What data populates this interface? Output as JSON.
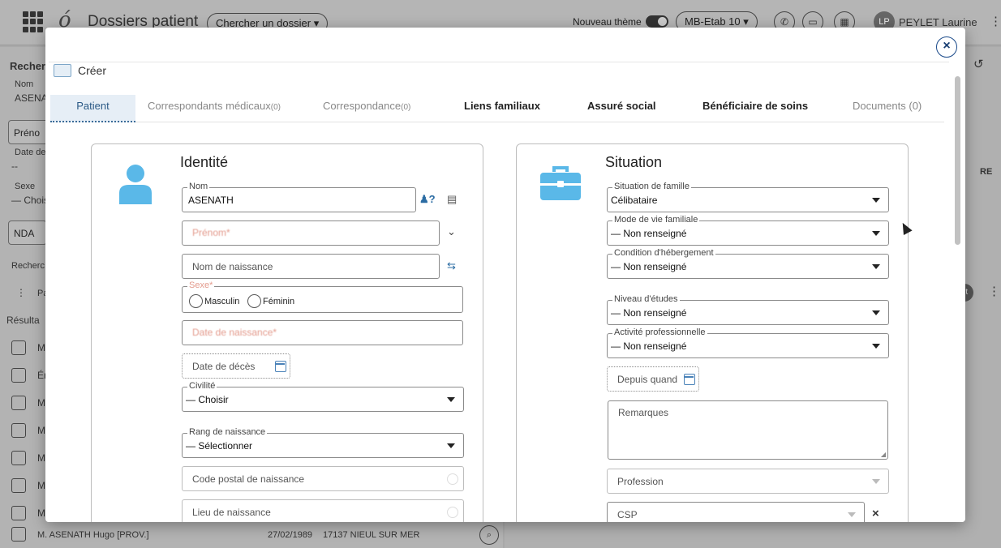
{
  "topbar": {
    "logo": "ó",
    "title": "Dossiers patient",
    "search_button": "Chercher un dossier",
    "theme_label": "Nouveau thème",
    "etab": "MB-Etab 10",
    "user_initials": "LP",
    "user_name": "PEYLET Laurine"
  },
  "background": {
    "search_heading": "Recher",
    "nom_label": "Nom",
    "nom_value": "ASENA",
    "prenom": "Préno",
    "dob_label": "Date de",
    "dob_value": "--",
    "sexe_label": "Sexe",
    "sexe_value": "— Chois",
    "nda": "NDA",
    "recherche_link": "Recherc",
    "results_label": "Résulta",
    "rows": [
      "M.",
      "Ér",
      "M",
      "M.",
      "M.",
      "M",
      "M"
    ],
    "last_row_name": "M. ASENATH Hugo [PROV.]",
    "last_row_date": "27/02/1989",
    "last_row_city": "17137 NIEUL SUR MER",
    "right_hint": "RE",
    "pa_col": "Pa",
    "et_badge": "et"
  },
  "modal": {
    "breadcrumb": "Créer",
    "close": "×",
    "tabs": [
      {
        "label": "Patient"
      },
      {
        "label": "Correspondants médicaux",
        "count": "(0)"
      },
      {
        "label": "Correspondance",
        "count": "(0)"
      },
      {
        "label": "Liens familiaux"
      },
      {
        "label": "Assuré social"
      },
      {
        "label": "Bénéficiaire de soins"
      },
      {
        "label": "Documents (0)"
      }
    ],
    "identite": {
      "title": "Identité",
      "nom_label": "Nom",
      "nom_value": "ASENATH",
      "prenom_placeholder": "Prénom*",
      "nom_naissance_placeholder": "Nom de naissance",
      "sexe_label": "Sexe*",
      "sexe_masculin": "Masculin",
      "sexe_feminin": "Féminin",
      "date_naissance_placeholder": "Date de naissance*",
      "date_deces_placeholder": "Date de décès",
      "civilite_label": "Civilité",
      "civilite_value": "— Choisir",
      "rang_label": "Rang de naissance",
      "rang_value": "— Sélectionner",
      "cp_naissance_placeholder": "Code postal de naissance",
      "lieu_naissance_placeholder": "Lieu de naissance"
    },
    "situation": {
      "title": "Situation",
      "famille_label": "Situation de famille",
      "famille_value": "Célibataire",
      "mode_vie_label": "Mode de vie familiale",
      "mode_vie_value": "— Non renseigné",
      "hebergement_label": "Condition d'hébergement",
      "hebergement_value": "— Non renseigné",
      "etudes_label": "Niveau d'études",
      "etudes_value": "— Non renseigné",
      "activite_label": "Activité professionnelle",
      "activite_value": "— Non renseigné",
      "depuis_placeholder": "Depuis quand",
      "remarques_placeholder": "Remarques",
      "profession_placeholder": "Profession",
      "csp_placeholder": "CSP"
    }
  },
  "icons": {
    "accent": "#5ab8e8",
    "link": "#2b6ca3"
  }
}
